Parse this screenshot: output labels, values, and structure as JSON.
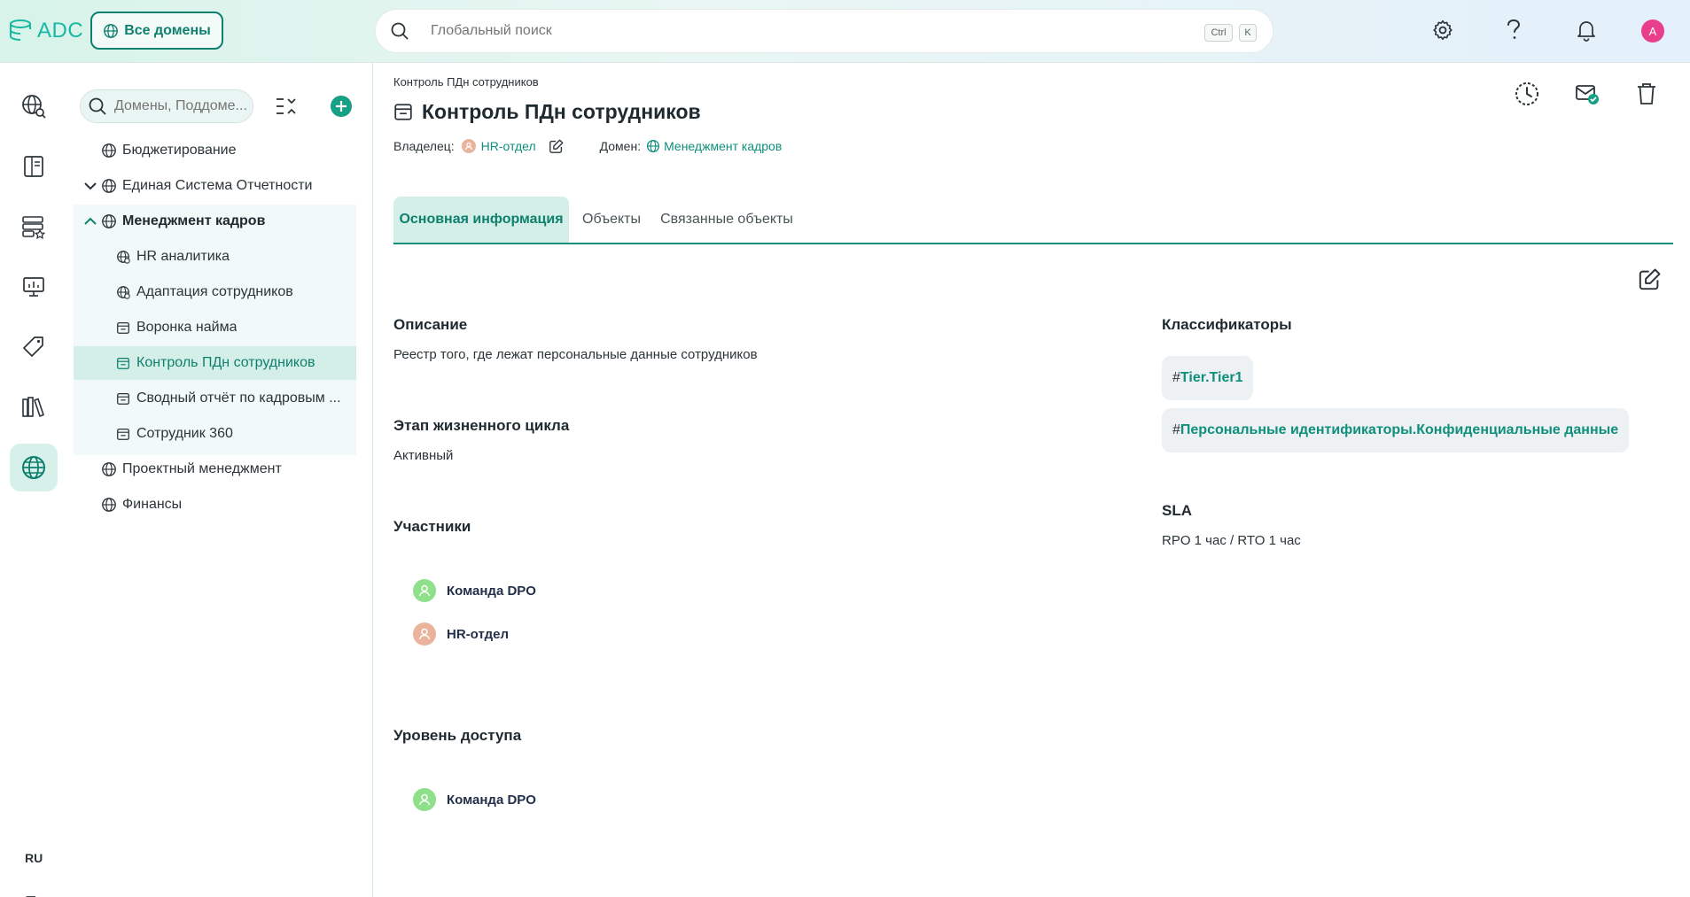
{
  "header": {
    "logo_text": "ADC",
    "domains_button": "Все домены",
    "search_placeholder": "Глобальный поиск",
    "shortcut_ctrl": "Ctrl",
    "shortcut_key": "K",
    "avatar_initial": "A",
    "accent_color": "#0f7f6e"
  },
  "rail": {
    "language": "RU"
  },
  "tree": {
    "search_placeholder": "Домены, Поддоме...",
    "items": [
      {
        "label": "Бюджетирование"
      },
      {
        "label": "Единая Система Отчетности"
      },
      {
        "label": "Менеджмент кадров"
      },
      {
        "label": "HR аналитика"
      },
      {
        "label": "Адаптация сотрудников"
      },
      {
        "label": "Воронка найма"
      },
      {
        "label": "Контроль ПДн сотрудников"
      },
      {
        "label": "Сводный отчёт по кадровым ..."
      },
      {
        "label": "Сотрудник 360"
      },
      {
        "label": "Проектный менеджмент"
      },
      {
        "label": "Финансы"
      }
    ]
  },
  "main": {
    "breadcrumb": "Контроль ПДн сотрудников",
    "title": "Контроль ПДн сотрудников",
    "owner_label": "Владелец:",
    "owner_value": "HR-отдел",
    "domain_label": "Домен:",
    "domain_value": "Менеджмент кадров",
    "tabs": [
      {
        "label": "Основная информация"
      },
      {
        "label": "Объекты"
      },
      {
        "label": "Связанные объекты"
      }
    ],
    "description_title": "Описание",
    "description_text": "Реестр того, где лежат персональные данные сотрудников",
    "lifecycle_title": "Этап жизненного цикла",
    "lifecycle_value": "Активный",
    "participants_title": "Участники",
    "participants": [
      {
        "name": "Команда DPO"
      },
      {
        "name": "HR-отдел"
      }
    ],
    "access_title": "Уровень доступа",
    "access": [
      {
        "name": "Команда DPO"
      }
    ],
    "classifiers_title": "Классификаторы",
    "classifiers": [
      {
        "hash": "#",
        "value": "Tier.Tier1"
      },
      {
        "hash": "#",
        "value": "Персональные идентификаторы.Конфиденциальные данные"
      }
    ],
    "sla_title": "SLA",
    "sla_value": "RPO 1 час / RTO 1 час"
  }
}
